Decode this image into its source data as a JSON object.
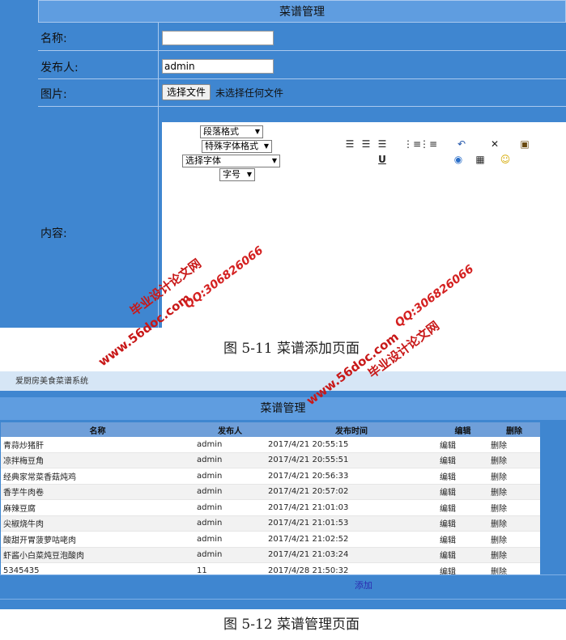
{
  "form": {
    "title": "菜谱管理",
    "name_label": "名称:",
    "name_value": "",
    "publisher_label": "发布人:",
    "publisher_value": "admin",
    "image_label": "图片:",
    "file_button": "选择文件",
    "file_status": "未选择任何文件",
    "content_label": "内容:",
    "editor": {
      "paragraph_format": "段落格式",
      "special_format": "特殊字体格式",
      "font_select": "选择字体",
      "font_size": "字号"
    }
  },
  "caption1": "图 5-11 菜谱添加页面",
  "list": {
    "site_strip": "爱厨房美食菜谱系统",
    "title": "菜谱管理",
    "columns": [
      "名称",
      "发布人",
      "发布时间",
      "编辑",
      "删除"
    ],
    "rows": [
      [
        "青蒜炒猪肝",
        "admin",
        "2017/4/21 20:55:15",
        "编辑",
        "删除"
      ],
      [
        "凉拌梅豆角",
        "admin",
        "2017/4/21 20:55:51",
        "编辑",
        "删除"
      ],
      [
        "经典家常菜香菇炖鸡",
        "admin",
        "2017/4/21 20:56:33",
        "编辑",
        "删除"
      ],
      [
        "香芋牛肉卷",
        "admin",
        "2017/4/21 20:57:02",
        "编辑",
        "删除"
      ],
      [
        "麻辣豆腐",
        "admin",
        "2017/4/21 21:01:03",
        "编辑",
        "删除"
      ],
      [
        "尖椒烧牛肉",
        "admin",
        "2017/4/21 21:01:53",
        "编辑",
        "删除"
      ],
      [
        "酸甜开胃菠萝咕咾肉",
        "admin",
        "2017/4/21 21:02:52",
        "编辑",
        "删除"
      ],
      [
        "虾酱小白菜炖豆泡酸肉",
        "admin",
        "2017/4/21 21:03:24",
        "编辑",
        "删除"
      ],
      [
        "5345435",
        "11",
        "2017/4/28 21:50:32",
        "编辑",
        "删除"
      ]
    ],
    "add_link": "添加"
  },
  "caption2": "图 5-12 菜谱管理页面",
  "watermark": {
    "site": "www.56doc.com",
    "brand": "毕业设计论文网",
    "qq": "QQ:306826066"
  },
  "colors": {
    "page_blue": "#3f86d0",
    "header_blue": "#5f9de0",
    "watermark_red": "#c81818"
  }
}
